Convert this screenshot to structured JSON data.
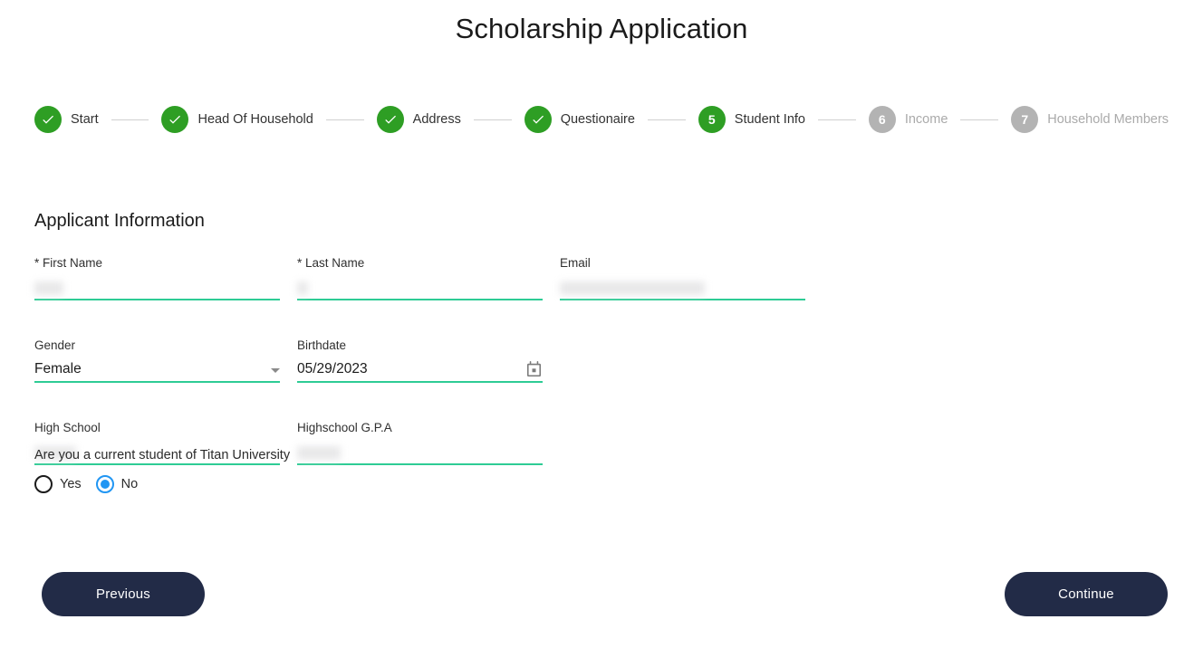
{
  "header": {
    "title": "Scholarship Application"
  },
  "stepper": {
    "steps": [
      {
        "number": "1",
        "label": "Start",
        "state": "done",
        "icon": "check-icon"
      },
      {
        "number": "2",
        "label": "Head Of Household",
        "state": "done",
        "icon": "check-icon"
      },
      {
        "number": "3",
        "label": "Address",
        "state": "done",
        "icon": "check-icon"
      },
      {
        "number": "4",
        "label": "Questionaire",
        "state": "done",
        "icon": "check-icon"
      },
      {
        "number": "5",
        "label": "Student Info",
        "state": "active",
        "icon": ""
      },
      {
        "number": "6",
        "label": "Income",
        "state": "todo",
        "icon": ""
      },
      {
        "number": "7",
        "label": "Household Members",
        "state": "todo",
        "icon": ""
      }
    ],
    "colors": {
      "done": "#2e9e24",
      "active": "#2e9e24",
      "todo": "#b3b3b3",
      "connector": "#cfcfcf",
      "label": "#323232",
      "label_muted": "#aaaaaa"
    }
  },
  "form": {
    "section_title": "Applicant Information",
    "underline_color": "#2ecc95",
    "fields": {
      "first_name": {
        "label": "* First Name",
        "value": "",
        "redacted": true,
        "placeholder": ""
      },
      "last_name": {
        "label": "* Last Name",
        "value": "",
        "redacted": true,
        "placeholder": ""
      },
      "email": {
        "label": "Email",
        "value": "",
        "redacted": true,
        "placeholder": ""
      },
      "gender": {
        "label": "Gender",
        "value": "Female",
        "redacted": false,
        "icon": "chevron-down-icon"
      },
      "birthdate": {
        "label": "Birthdate",
        "value": "05/29/2023",
        "redacted": false,
        "icon": "calendar-icon"
      },
      "high_school": {
        "label": "High School",
        "value": "",
        "redacted": true,
        "placeholder": ""
      },
      "gpa": {
        "label": "Highschool G.P.A",
        "value": "",
        "redacted": true,
        "placeholder": ""
      }
    }
  },
  "radio_group": {
    "question": "Are you a current student of Titan University",
    "selected": "No",
    "accent_color": "#2196f3",
    "options": [
      {
        "label": "Yes",
        "checked": false
      },
      {
        "label": "No",
        "checked": true
      }
    ]
  },
  "footer": {
    "previous_label": "Previous",
    "continue_label": "Continue",
    "button_color": "#222b47"
  }
}
